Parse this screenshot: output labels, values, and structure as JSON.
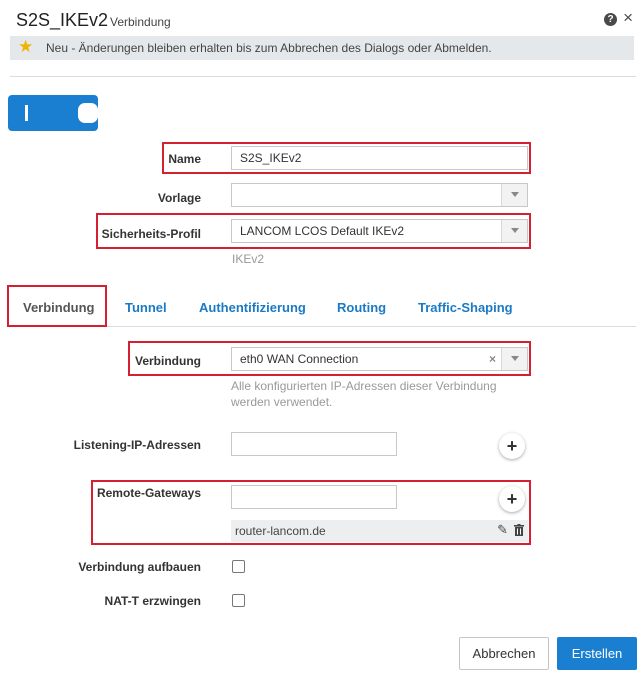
{
  "dialog": {
    "title": "S2S_IKEv2",
    "subtitle": "Verbindung",
    "help_glyph": "?",
    "close_glyph": "×"
  },
  "notice": {
    "icon": "star-icon",
    "text": "Neu - Änderungen bleiben erhalten bis zum Abbrechen des Dialogs oder Abmelden."
  },
  "toggle": {
    "state": "on"
  },
  "form": {
    "name": {
      "label": "Name",
      "value": "S2S_IKEv2"
    },
    "vorlage": {
      "label": "Vorlage",
      "value": ""
    },
    "profil": {
      "label": "Sicherheits-Profil",
      "value": "LANCOM LCOS Default IKEv2",
      "hint": "IKEv2"
    }
  },
  "tabs": [
    {
      "label": "Verbindung",
      "active": true
    },
    {
      "label": "Tunnel",
      "active": false
    },
    {
      "label": "Authentifizierung",
      "active": false
    },
    {
      "label": "Routing",
      "active": false
    },
    {
      "label": "Traffic-Shaping",
      "active": false
    }
  ],
  "verbindung": {
    "connection": {
      "label": "Verbindung",
      "value": "eth0 WAN Connection",
      "clear_glyph": "×",
      "hint_line1": "Alle konfigurierten IP-Adressen dieser Verbindung",
      "hint_line2": "werden verwendet."
    },
    "listening": {
      "label": "Listening-IP-Adressen",
      "value": ""
    },
    "remote": {
      "label": "Remote-Gateways",
      "value": "",
      "entries": [
        "router-lancom.de"
      ]
    },
    "aufbauen": {
      "label": "Verbindung aufbauen",
      "checked": false
    },
    "natt": {
      "label": "NAT-T erzwingen",
      "checked": false
    },
    "add_glyph": "+",
    "edit_glyph": "✎"
  },
  "buttons": {
    "cancel": "Abbrechen",
    "create": "Erstellen"
  },
  "colors": {
    "accent": "#1a7fd0",
    "highlight": "#d42030",
    "star": "#f0b400"
  }
}
